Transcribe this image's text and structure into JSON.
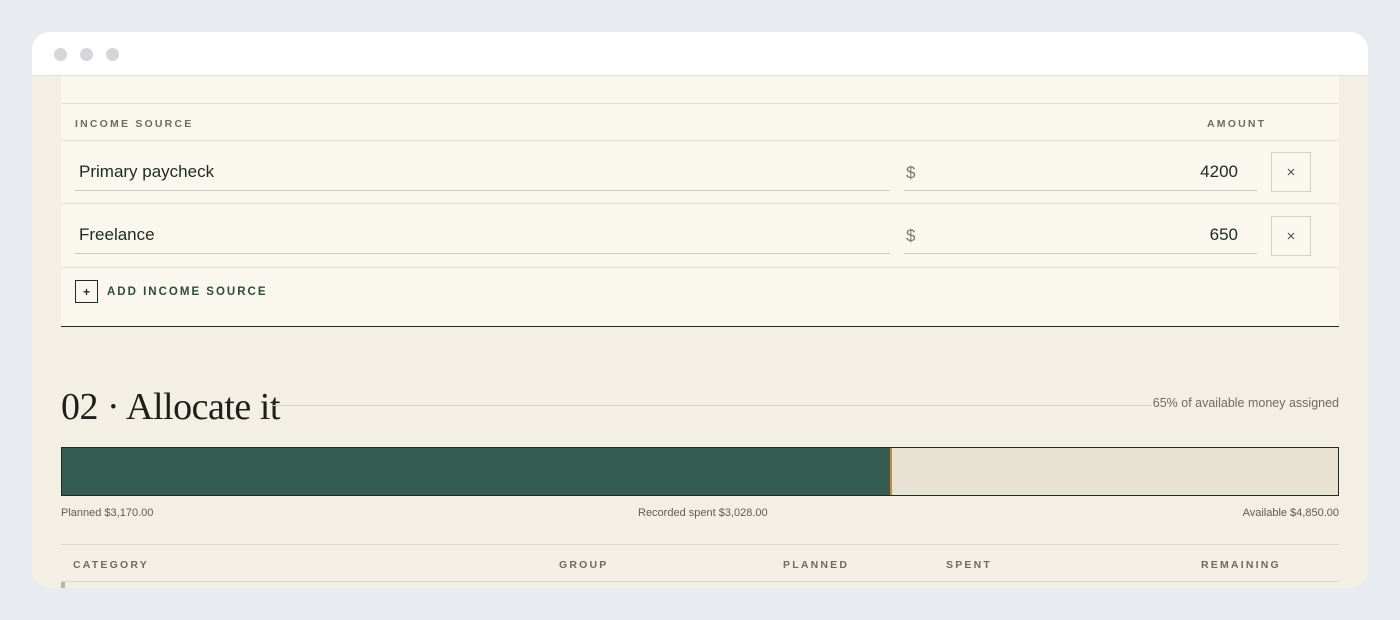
{
  "income": {
    "columns": {
      "source": "INCOME SOURCE",
      "amount": "AMOUNT"
    },
    "rows": [
      {
        "name": "Primary paycheck",
        "currency": "$",
        "amount": "4200",
        "remove": "×"
      },
      {
        "name": "Freelance",
        "currency": "$",
        "amount": "650",
        "remove": "×"
      }
    ],
    "add_icon": "+",
    "add_label": "ADD INCOME SOURCE"
  },
  "allocate": {
    "title": "02 · Allocate it",
    "assigned_text": "65% of available money assigned",
    "progress_fraction": 0.65,
    "planned": "Planned $3,170.00",
    "spent": "Recorded spent $3,028.00",
    "available": "Available $4,850.00"
  },
  "categories_table": {
    "columns": [
      "CATEGORY",
      "GROUP",
      "PLANNED",
      "SPENT",
      "REMAINING"
    ]
  },
  "colors": {
    "progress_fill": "#345c50",
    "progress_track": "#e8e2d3",
    "progress_marker": "#c48a3c",
    "page_background": "#f4efe4",
    "card_background": "#faf7ee"
  },
  "icons": {
    "remove": "close-icon",
    "add": "plus-icon",
    "window_controls": [
      "window-dot-icon",
      "window-dot-icon",
      "window-dot-icon"
    ]
  }
}
